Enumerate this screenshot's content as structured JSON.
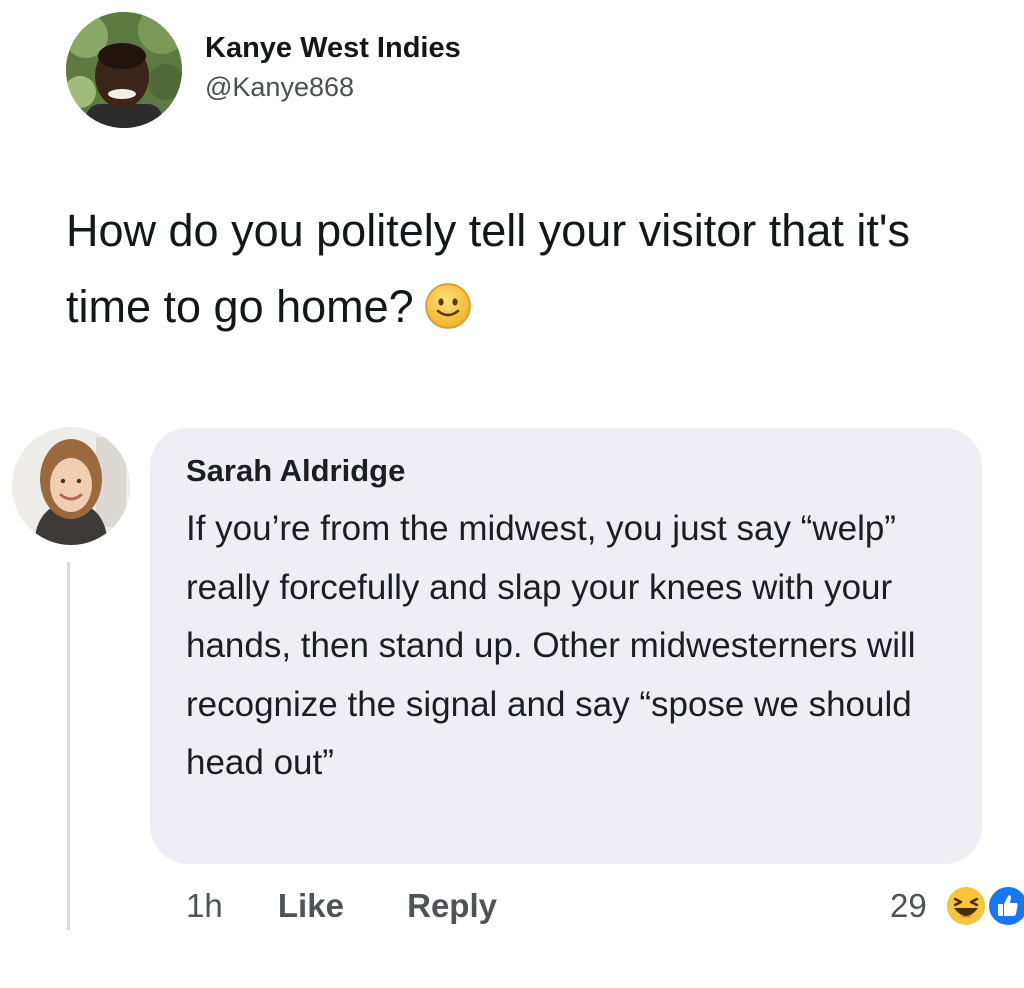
{
  "tweet": {
    "author_name": "Kanye West Indies",
    "author_handle": "@Kanye868",
    "text": "How do you politely tell your visitor that it's time to go home?",
    "emoji": "slightly-smiling-face-icon"
  },
  "comment": {
    "author_name": "Sarah Aldridge",
    "text": "If you’re from the midwest, you just say “welp” really forcefully and slap your knees with your hands, then stand up. Other midwesterners will recognize the signal and say “spose we should head out”",
    "time": "1h",
    "like_label": "Like",
    "reply_label": "Reply",
    "reaction_count": "29",
    "reactions": [
      "haha-icon",
      "like-icon"
    ]
  },
  "colors": {
    "bubble_background": "#eeeef4",
    "emoji_yellow": "#f7c53a",
    "like_blue": "#1877f2"
  }
}
